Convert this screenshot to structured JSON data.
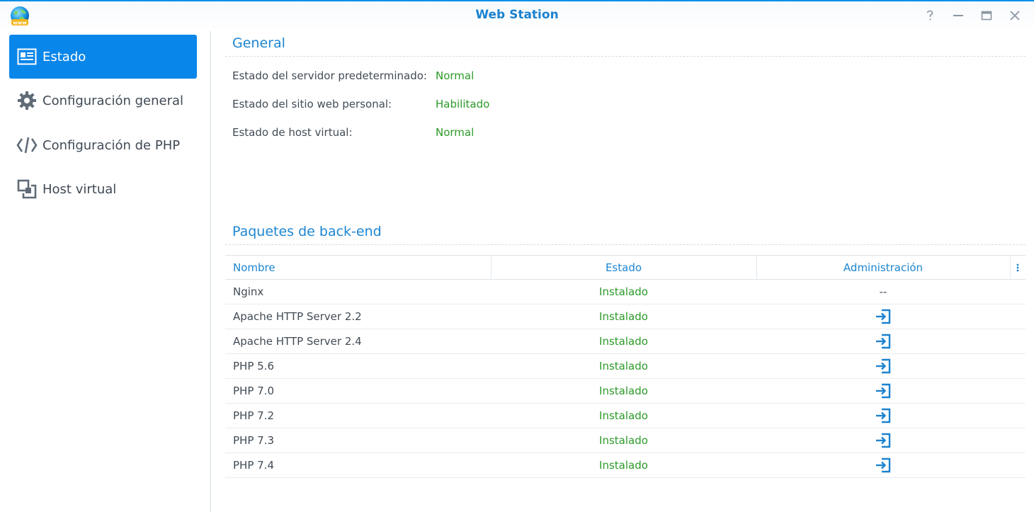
{
  "window": {
    "title": "Web Station",
    "app_icon": "web-station-globe-icon",
    "controls": [
      "help-icon",
      "minimize-icon",
      "maximize-icon",
      "close-icon"
    ],
    "accent_color": "#0a8fe8"
  },
  "sidebar": {
    "items": [
      {
        "label": "Estado",
        "icon": "status-card-icon",
        "active": true
      },
      {
        "label": "Configuración general",
        "icon": "gear-icon",
        "active": false
      },
      {
        "label": "Configuración de PHP",
        "icon": "code-brackets-icon",
        "active": false
      },
      {
        "label": "Host virtual",
        "icon": "virtual-host-icon",
        "active": false
      }
    ]
  },
  "general": {
    "title": "General",
    "fields": [
      {
        "label": "Estado del servidor predeterminado:",
        "value": "Normal"
      },
      {
        "label": "Estado del sitio web personal:",
        "value": "Habilitado"
      },
      {
        "label": "Estado de host virtual:",
        "value": "Normal"
      }
    ]
  },
  "backend": {
    "title": "Paquetes de back-end",
    "columns": {
      "name": "Nombre",
      "status": "Estado",
      "admin": "Administración"
    },
    "rows": [
      {
        "name": "Nginx",
        "status": "Instalado",
        "admin": "--"
      },
      {
        "name": "Apache HTTP Server 2.2",
        "status": "Instalado",
        "admin": "open-icon"
      },
      {
        "name": "Apache HTTP Server 2.4",
        "status": "Instalado",
        "admin": "open-icon"
      },
      {
        "name": "PHP 5.6",
        "status": "Instalado",
        "admin": "open-icon"
      },
      {
        "name": "PHP 7.0",
        "status": "Instalado",
        "admin": "open-icon"
      },
      {
        "name": "PHP 7.2",
        "status": "Instalado",
        "admin": "open-icon"
      },
      {
        "name": "PHP 7.3",
        "status": "Instalado",
        "admin": "open-icon"
      },
      {
        "name": "PHP 7.4",
        "status": "Instalado",
        "admin": "open-icon"
      }
    ]
  },
  "colors": {
    "link_blue": "#1c86d1",
    "status_green": "#2c9a29",
    "active_nav": "#0986ea"
  }
}
